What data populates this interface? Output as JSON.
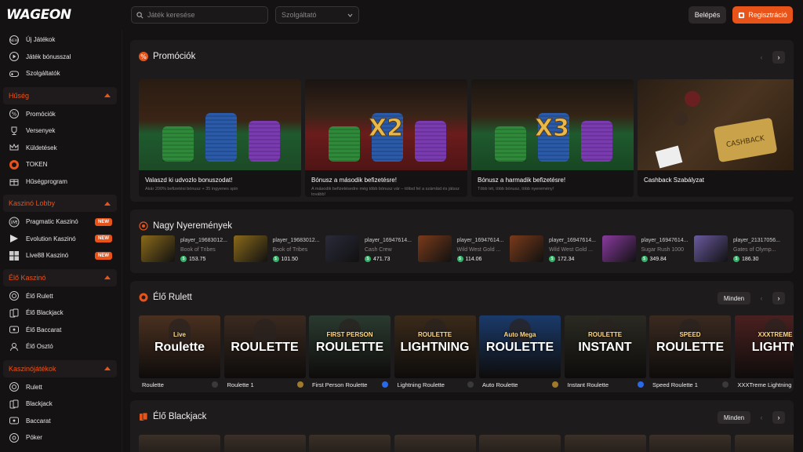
{
  "header": {
    "logo": "WAGEON",
    "search_placeholder": "Játék keresése",
    "provider_label": "Szolgáltató",
    "login_label": "Belépés",
    "register_label": "Regisztráció"
  },
  "sidebar": {
    "top_items": [
      {
        "label": "Új Játékok",
        "icon": "new-icon"
      },
      {
        "label": "Játék bónusszal",
        "icon": "play-bonus-icon"
      },
      {
        "label": "Szolgáltatók",
        "icon": "gamepad-icon"
      }
    ],
    "sections": [
      {
        "title": "Hűség",
        "items": [
          {
            "label": "Promóciók",
            "icon": "percent-icon"
          },
          {
            "label": "Versenyek",
            "icon": "trophy-icon"
          },
          {
            "label": "Küldetések",
            "icon": "crown-icon"
          },
          {
            "label": "TOKEN",
            "icon": "token-icon"
          },
          {
            "label": "Hűségprogram",
            "icon": "gift-icon"
          }
        ]
      },
      {
        "title": "Kaszinó Lobby",
        "items": [
          {
            "label": "Pragmatic Kaszinó",
            "icon": "live-icon",
            "badge": "NEW"
          },
          {
            "label": "Evolution Kaszinó",
            "icon": "evolution-icon",
            "badge": "NEW"
          },
          {
            "label": "Live88 Kaszinó",
            "icon": "live88-icon",
            "badge": "NEW"
          }
        ]
      },
      {
        "title": "Élő Kaszinó",
        "items": [
          {
            "label": "Élő Rulett",
            "icon": "roulette-icon"
          },
          {
            "label": "Élő Blackjack",
            "icon": "cards-icon"
          },
          {
            "label": "Élő Baccarat",
            "icon": "baccarat-icon"
          },
          {
            "label": "Élő Osztó",
            "icon": "dealer-icon"
          }
        ]
      },
      {
        "title": "Kaszinójátékok",
        "items": [
          {
            "label": "Rulett",
            "icon": "roulette-icon"
          },
          {
            "label": "Blackjack",
            "icon": "cards-icon"
          },
          {
            "label": "Baccarat",
            "icon": "baccarat-icon"
          },
          {
            "label": "Póker",
            "icon": "poker-icon"
          }
        ]
      }
    ]
  },
  "promotions": {
    "title": "Promóciók",
    "cards": [
      {
        "title": "Valaszd ki udvozlo bonuszodat!",
        "desc": "Akár 200% befizetési bónusz + 35 ingyenes spin",
        "art": "chips"
      },
      {
        "title": "Bónusz a második befizetésre!",
        "desc": "A második befizetésedre még több bónusz vár – töltsd fel a számlád és játssz tovább!",
        "art": "x2",
        "overlay": "X2"
      },
      {
        "title": "Bónusz a harmadik befizetésre!",
        "desc": "Több tét, több bónusz, több nyeremény!",
        "art": "x3",
        "overlay": "X3"
      },
      {
        "title": "Cashback Szabályzat",
        "desc": "",
        "art": "cashback",
        "overlay": "CASHBACK"
      }
    ]
  },
  "big_wins": {
    "title": "Nagy Nyeremények",
    "items": [
      {
        "player": "player_19683012...",
        "game": "Book of Tribes",
        "amount": "153.75",
        "color": "#8a6a1a"
      },
      {
        "player": "player_19683012...",
        "game": "Book of Tribes",
        "amount": "101.50",
        "color": "#8a6a1a"
      },
      {
        "player": "player_16947614...",
        "game": "Cash Crew",
        "amount": "471.73",
        "color": "#2a2a3a"
      },
      {
        "player": "player_16947614...",
        "game": "Wild West Gold ...",
        "amount": "114.06",
        "color": "#7a3a1a"
      },
      {
        "player": "player_16947614...",
        "game": "Wild West Gold ...",
        "amount": "172.34",
        "color": "#7a3a1a"
      },
      {
        "player": "player_16947614...",
        "game": "Sugar Rush 1000",
        "amount": "349.84",
        "color": "#8a3aa0"
      },
      {
        "player": "player_21317056...",
        "game": "Gates of Olymp...",
        "amount": "186.30",
        "color": "#6a5aa0"
      }
    ]
  },
  "roulette": {
    "title": "Élő Rulett",
    "all_label": "Minden",
    "games": [
      {
        "name": "Roulette",
        "banner": "Roulette",
        "sub": "Live",
        "bg": "#4a3020"
      },
      {
        "name": "Roulette 1",
        "banner": "ROULETTE",
        "sub": "",
        "bg": "#3a2a20"
      },
      {
        "name": "First Person Roulette",
        "banner": "ROULETTE",
        "sub": "FIRST PERSON",
        "bg": "#2a3a30"
      },
      {
        "name": "Lightning Roulette",
        "banner": "LIGHTNING",
        "sub": "ROULETTE",
        "bg": "#3a2a1a"
      },
      {
        "name": "Auto Roulette",
        "banner": "ROULETTE",
        "sub": "Auto Mega",
        "bg": "#1a3a6a"
      },
      {
        "name": "Instant Roulette",
        "banner": "INSTANT",
        "sub": "ROULETTE",
        "bg": "#2a2a22"
      },
      {
        "name": "Speed Roulette 1",
        "banner": "ROULETTE",
        "sub": "SPEED",
        "bg": "#3a2a20"
      },
      {
        "name": "XXXTreme Lightning",
        "banner": "LIGHTN",
        "sub": "XXXTREME",
        "bg": "#4a2020"
      }
    ]
  },
  "blackjack": {
    "title": "Élő Blackjack",
    "all_label": "Minden"
  },
  "colors": {
    "accent": "#e8531a",
    "bg": "#141213",
    "panel": "#1e1b1c"
  }
}
